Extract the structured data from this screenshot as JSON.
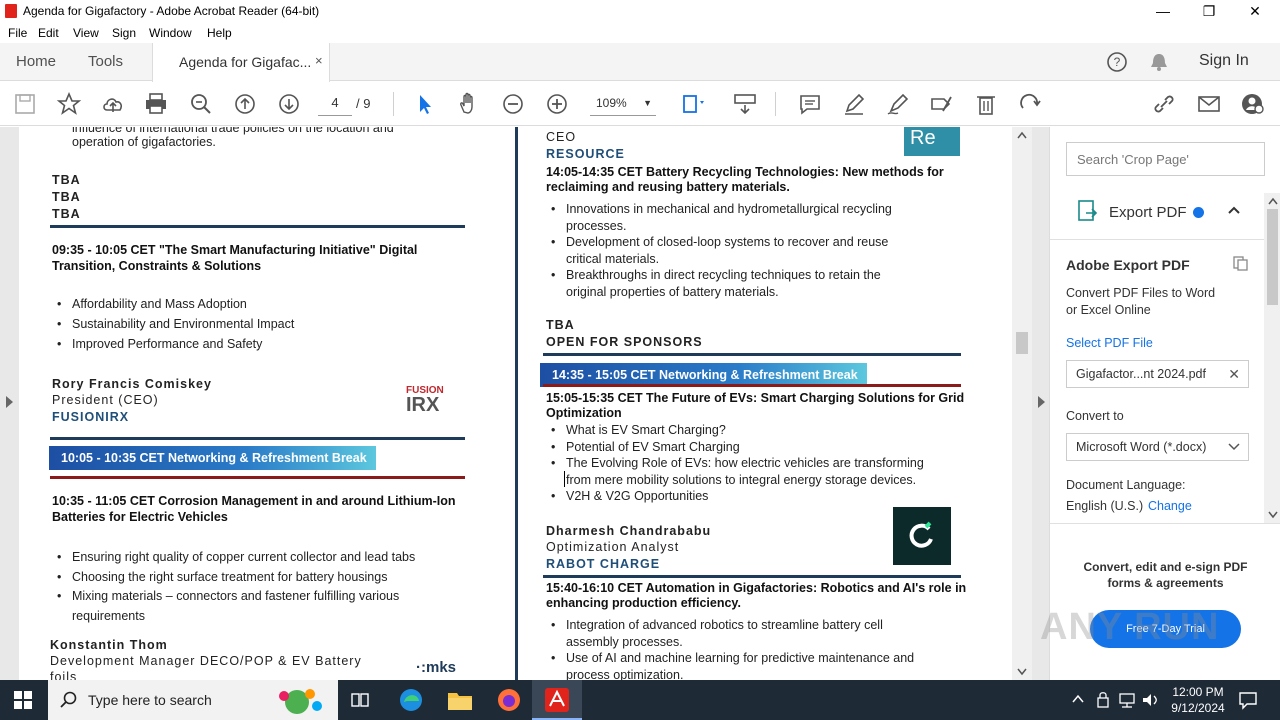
{
  "window": {
    "title": "Agenda for Gigafactory - Adobe Acrobat Reader (64-bit)",
    "minimize": "—",
    "maximize": "❐",
    "close": "✕"
  },
  "menu": [
    "File",
    "Edit",
    "View",
    "Sign",
    "Window",
    "Help"
  ],
  "tabs": {
    "home": "Home",
    "tools": "Tools",
    "document": "Agenda for Gigafac...",
    "close": "×",
    "sign_in": "Sign In"
  },
  "toolbar": {
    "page_current": "4",
    "page_total": "/ 9",
    "zoom": "109%"
  },
  "doc": {
    "left": {
      "intro_line1": "influence of international trade policies on the location and",
      "intro_line2": "operation of gigafactories.",
      "tba1": "TBA",
      "tba2": "TBA",
      "tba3": "TBA",
      "session1_line1": "09:35 - 10:05 CET \"The Smart Manufacturing Initiative\" Digital",
      "session1_line2": "Transition, Constraints & Solutions",
      "session1_bullets": [
        "Affordability and Mass Adoption",
        "Sustainability and Environmental Impact",
        "Improved Performance and Safety"
      ],
      "speaker1_name": "Rory Francis Comiskey",
      "speaker1_role": "President (CEO)",
      "speaker1_company": "FUSIONIRX",
      "logo1_top": "FUSION",
      "logo1_bottom": "IRX",
      "break1": "10:05 - 10:35 CET Networking & Refreshment Break",
      "session2_line1": "10:35 - 11:05 CET Corrosion Management in and around Lithium-Ion",
      "session2_line2": "Batteries for Electric Vehicles",
      "session2_bullets": [
        "Ensuring right quality of copper current collector and lead tabs",
        "Choosing the right surface treatment for battery housings",
        "Mixing materials – connectors and fastener fulfilling various"
      ],
      "session2_bullet3_cont": "requirements",
      "speaker2_name": "Konstantin Thom",
      "speaker2_role": "Development Manager DECO/POP & EV Battery",
      "speaker2_role_cont": "foils",
      "logo2": "mks"
    },
    "right": {
      "ceo": "CEO",
      "resource": "RESOURCE",
      "logo_re": "Re",
      "session3_line1": "14:05-14:35 CET  Battery Recycling Technologies: New methods for",
      "session3_line2": "reclaiming and reusing battery materials.",
      "session3_b1a": "Innovations in mechanical and hydrometallurgical recycling",
      "session3_b1b": "processes.",
      "session3_b2a": "Development of closed-loop systems to recover and reuse",
      "session3_b2b": "critical materials.",
      "session3_b3a": "Breakthroughs in direct recycling techniques to retain the",
      "session3_b3b": "original properties of battery materials.",
      "tba": "TBA",
      "open_sponsors": "OPEN FOR SPONSORS",
      "break2": "14:35 - 15:05 CET Networking & Refreshment Break",
      "session4_line1": "15:05-15:35 CET The Future of EVs: Smart Charging Solutions for Grid",
      "session4_line2": "Optimization",
      "session4_b1": "What is EV Smart Charging?",
      "session4_b2": "Potential of EV Smart Charging",
      "session4_b3a": "The Evolving Role of EVs: how electric vehicles are transforming",
      "session4_b3b": "from mere mobility solutions to integral energy storage devices.",
      "session4_b4": "V2H & V2G Opportunities",
      "speaker3_name": "Dharmesh Chandrababu",
      "speaker3_role": "Optimization Analyst",
      "speaker3_company": "RABOT CHARGE",
      "session5_line1": "15:40-16:10 CET Automation in Gigafactories: Robotics and AI's role in",
      "session5_line2": "enhancing production efficiency.",
      "session5_b1a": "Integration of advanced robotics to streamline battery cell",
      "session5_b1b": "assembly processes.",
      "session5_b2a": "Use of AI and machine learning for predictive maintenance and",
      "session5_b2b": "process optimization."
    }
  },
  "panel": {
    "search_placeholder": "Search 'Crop Page'",
    "export_title": "Export PDF",
    "heading": "Adobe Export PDF",
    "desc_line1": "Convert PDF Files to Word",
    "desc_line2": "or Excel Online",
    "select_file": "Select PDF File",
    "file_name": "Gigafactor...nt 2024.pdf",
    "convert_to": "Convert to",
    "format": "Microsoft Word (*.docx)",
    "doc_language": "Document Language:",
    "language": "English (U.S.)",
    "change": "Change",
    "promo_line1": "Convert, edit and e-sign PDF",
    "promo_line2": "forms & agreements",
    "trial_button": "Free 7-Day Trial"
  },
  "taskbar": {
    "search_placeholder": "Type here to search",
    "time": "12:00 PM",
    "date": "9/12/2024"
  },
  "watermark": "ANY RUN"
}
